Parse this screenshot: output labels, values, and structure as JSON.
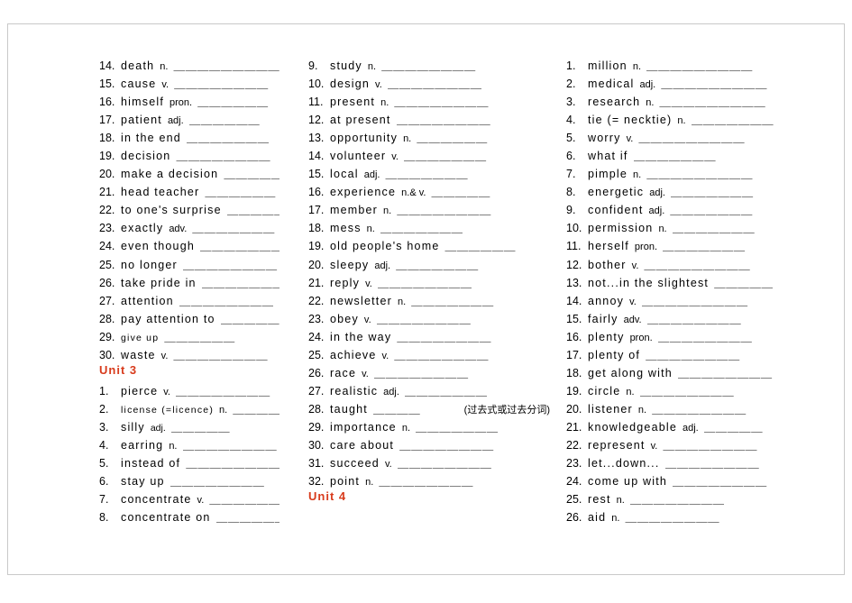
{
  "document": {
    "title": "English Vocabulary Worksheet",
    "blank_char": "_",
    "columns": [
      {
        "id": "column-1",
        "entries": [
          {
            "num": "14.",
            "word": "death",
            "pos": "n.",
            "blanks": "＿＿＿＿＿＿＿＿＿"
          },
          {
            "num": "15.",
            "word": "cause",
            "pos": "v.",
            "blanks": "＿＿＿＿＿＿＿＿"
          },
          {
            "num": "16.",
            "word": "himself",
            "pos": "pron.",
            "blanks": "＿＿＿＿＿＿"
          },
          {
            "num": "17.",
            "word": "patient",
            "pos": "adj.",
            "blanks": "＿＿＿＿＿＿"
          },
          {
            "num": "18.",
            "word": "in the end",
            "pos": "",
            "blanks": "＿＿＿＿＿＿＿"
          },
          {
            "num": "19.",
            "word": "decision",
            "pos": "",
            "blanks": "＿＿＿＿＿＿＿＿"
          },
          {
            "num": "20.",
            "word": "make a decision",
            "pos": "",
            "blanks": "＿＿＿＿＿"
          },
          {
            "num": "21.",
            "word": "head teacher",
            "pos": "",
            "blanks": "＿＿＿＿＿＿"
          },
          {
            "num": "22.",
            "word": "to one's surprise",
            "pos": "",
            "blanks": "＿＿＿＿＿＿"
          },
          {
            "num": "23.",
            "word": "exactly",
            "pos": "adv.",
            "blanks": "＿＿＿＿＿＿＿"
          },
          {
            "num": "24.",
            "word": "even though",
            "pos": "",
            "blanks": "＿＿＿＿＿＿＿＿"
          },
          {
            "num": "25.",
            "word": "no longer",
            "pos": "",
            "blanks": "＿＿＿＿＿＿＿＿"
          },
          {
            "num": "26.",
            "word": "take pride in",
            "pos": "",
            "blanks": "＿＿＿＿＿＿＿＿"
          },
          {
            "num": "27.",
            "word": "attention",
            "pos": "",
            "blanks": "＿＿＿＿＿＿＿＿"
          },
          {
            "num": "28.",
            "word": "pay attention to",
            "pos": "",
            "blanks": "＿＿＿＿＿＿"
          },
          {
            "num": "29.",
            "word": "give up",
            "pos": "",
            "blanks": "＿＿＿＿＿＿",
            "small_word": true
          },
          {
            "num": "30.",
            "word": "waste",
            "pos": "v.",
            "blanks": "＿＿＿＿＿＿＿＿"
          }
        ],
        "unit_heading": "Unit 3",
        "entries_after_unit": [
          {
            "num": "1.",
            "word": "pierce",
            "pos": "v.",
            "blanks": "＿＿＿＿＿＿＿＿"
          },
          {
            "num": "2.",
            "word": "license (=licence)",
            "pos": "n.",
            "blanks": "＿＿＿＿＿",
            "small_word": true
          },
          {
            "num": "3.",
            "word": "silly",
            "pos": "adj.",
            "blanks": "＿＿＿＿＿",
            "small_pos": true
          },
          {
            "num": "4.",
            "word": "earring",
            "pos": "n.",
            "blanks": "＿＿＿＿＿＿＿＿"
          },
          {
            "num": "5.",
            "word": "instead of",
            "pos": "",
            "blanks": "＿＿＿＿＿＿＿＿"
          },
          {
            "num": "6.",
            "word": "stay up",
            "pos": "",
            "blanks": "＿＿＿＿＿＿＿＿"
          },
          {
            "num": "7.",
            "word": "concentrate",
            "pos": "v.",
            "blanks": "＿＿＿＿＿＿"
          },
          {
            "num": "8.",
            "word": "concentrate on",
            "pos": "",
            "blanks": "＿＿＿＿＿＿＿＿"
          }
        ]
      },
      {
        "id": "column-2",
        "entries": [
          {
            "num": "9.",
            "word": "study",
            "pos": "n.",
            "blanks": "＿＿＿＿＿＿＿＿"
          },
          {
            "num": "10.",
            "word": "design",
            "pos": "v.",
            "blanks": "＿＿＿＿＿＿＿＿"
          },
          {
            "num": "11.",
            "word": "present",
            "pos": "n.",
            "blanks": "＿＿＿＿＿＿＿＿"
          },
          {
            "num": "12.",
            "word": "at present",
            "pos": "",
            "blanks": "＿＿＿＿＿＿＿＿"
          },
          {
            "num": "13.",
            "word": "opportunity",
            "pos": "n.",
            "blanks": "＿＿＿＿＿＿"
          },
          {
            "num": "14.",
            "word": "volunteer",
            "pos": "v.",
            "blanks": "＿＿＿＿＿＿＿"
          },
          {
            "num": "15.",
            "word": "local",
            "pos": "adj.",
            "blanks": "＿＿＿＿＿＿＿"
          },
          {
            "num": "16.",
            "word": "experience",
            "pos": "n.& v.",
            "blanks": "＿＿＿＿＿"
          },
          {
            "num": "17.",
            "word": "member",
            "pos": "n.",
            "blanks": "＿＿＿＿＿＿＿＿"
          },
          {
            "num": "18.",
            "word": "mess",
            "pos": "n.",
            "blanks": "＿＿＿＿＿＿＿"
          },
          {
            "num": "19.",
            "word": "old people's home",
            "pos": "",
            "blanks": "＿＿＿＿＿＿"
          },
          {
            "num": "20.",
            "word": "sleepy",
            "pos": "adj.",
            "blanks": "＿＿＿＿＿＿＿"
          },
          {
            "num": "21.",
            "word": "reply",
            "pos": "v.",
            "blanks": "＿＿＿＿＿＿＿＿"
          },
          {
            "num": "22.",
            "word": "newsletter",
            "pos": "n.",
            "blanks": "＿＿＿＿＿＿＿"
          },
          {
            "num": "23.",
            "word": "obey",
            "pos": "v.",
            "blanks": "＿＿＿＿＿＿＿＿"
          },
          {
            "num": "24.",
            "word": "in the way",
            "pos": "",
            "blanks": "＿＿＿＿＿＿＿＿"
          },
          {
            "num": "25.",
            "word": "achieve",
            "pos": "v.",
            "blanks": "＿＿＿＿＿＿＿＿"
          },
          {
            "num": "26.",
            "word": "race",
            "pos": "v.",
            "blanks": "＿＿＿＿＿＿＿＿"
          },
          {
            "num": "27.",
            "word": "realistic",
            "pos": "adj.",
            "blanks": "＿＿＿＿＿＿＿"
          },
          {
            "num": "28.",
            "word": "taught",
            "pos": "",
            "blanks": "＿＿＿＿",
            "suffix_cn": "(过去式或过去分词)"
          },
          {
            "num": "29.",
            "word": "importance",
            "pos": "n.",
            "blanks": "＿＿＿＿＿＿＿"
          },
          {
            "num": "30.",
            "word": "care about",
            "pos": "",
            "blanks": "＿＿＿＿＿＿＿＿"
          },
          {
            "num": "31.",
            "word": "succeed",
            "pos": "v.",
            "blanks": "＿＿＿＿＿＿＿＿"
          },
          {
            "num": "32.",
            "word": "point",
            "pos": "n.",
            "blanks": "＿＿＿＿＿＿＿＿"
          }
        ],
        "unit_heading": "Unit 4",
        "entries_after_unit": []
      },
      {
        "id": "column-3",
        "entries": [
          {
            "num": "1.",
            "word": "million",
            "pos": "n.",
            "blanks": "＿＿＿＿＿＿＿＿＿"
          },
          {
            "num": "2.",
            "word": "medical",
            "pos": "adj.",
            "blanks": "＿＿＿＿＿＿＿＿＿"
          },
          {
            "num": "3.",
            "word": "research",
            "pos": "n.",
            "blanks": "＿＿＿＿＿＿＿＿＿"
          },
          {
            "num": "4.",
            "word": "tie (= necktie)",
            "pos": "n.",
            "blanks": "＿＿＿＿＿＿＿"
          },
          {
            "num": "5.",
            "word": "worry",
            "pos": "v.",
            "blanks": "＿＿＿＿＿＿＿＿＿"
          },
          {
            "num": "6.",
            "word": "what if",
            "pos": "",
            "blanks": "＿＿＿＿＿＿＿"
          },
          {
            "num": "7.",
            "word": "pimple",
            "pos": "n.",
            "blanks": "＿＿＿＿＿＿＿＿＿"
          },
          {
            "num": "8.",
            "word": "energetic",
            "pos": "adj.",
            "blanks": "＿＿＿＿＿＿＿"
          },
          {
            "num": "9.",
            "word": "confident",
            "pos": "adj.",
            "blanks": "＿＿＿＿＿＿＿"
          },
          {
            "num": "10.",
            "word": "permission",
            "pos": "n.",
            "blanks": "＿＿＿＿＿＿＿"
          },
          {
            "num": "11.",
            "word": "herself",
            "pos": "pron.",
            "blanks": "＿＿＿＿＿＿＿"
          },
          {
            "num": "12.",
            "word": "bother",
            "pos": "v.",
            "blanks": "＿＿＿＿＿＿＿＿＿"
          },
          {
            "num": "13.",
            "word": "not...in the slightest",
            "pos": "",
            "blanks": "＿＿＿＿＿"
          },
          {
            "num": "14.",
            "word": "annoy",
            "pos": "v.",
            "blanks": "＿＿＿＿＿＿＿＿＿"
          },
          {
            "num": "15.",
            "word": "fairly",
            "pos": "adv.",
            "blanks": "＿＿＿＿＿＿＿＿"
          },
          {
            "num": "16.",
            "word": "plenty",
            "pos": "pron.",
            "blanks": "＿＿＿＿＿＿＿＿"
          },
          {
            "num": "17.",
            "word": "plenty of",
            "pos": "",
            "blanks": "＿＿＿＿＿＿＿＿"
          },
          {
            "num": "18.",
            "word": "get along with",
            "pos": "",
            "blanks": "＿＿＿＿＿＿＿＿"
          },
          {
            "num": "19.",
            "word": "circle",
            "pos": "n.",
            "blanks": "＿＿＿＿＿＿＿＿"
          },
          {
            "num": "20.",
            "word": "listener",
            "pos": "n.",
            "blanks": "＿＿＿＿＿＿＿＿"
          },
          {
            "num": "21.",
            "word": "knowledgeable",
            "pos": "adj.",
            "blanks": "＿＿＿＿＿"
          },
          {
            "num": "22.",
            "word": "represent",
            "pos": "v.",
            "blanks": "＿＿＿＿＿＿＿＿"
          },
          {
            "num": "23.",
            "word": "let...down...",
            "pos": "",
            "blanks": "＿＿＿＿＿＿＿＿"
          },
          {
            "num": "24.",
            "word": "come up with",
            "pos": "",
            "blanks": "＿＿＿＿＿＿＿＿"
          },
          {
            "num": "25.",
            "word": "rest",
            "pos": "n.",
            "blanks": "＿＿＿＿＿＿＿＿"
          },
          {
            "num": "26.",
            "word": "aid",
            "pos": "n.",
            "blanks": "＿＿＿＿＿＿＿＿"
          }
        ],
        "unit_heading": "",
        "entries_after_unit": []
      }
    ]
  }
}
